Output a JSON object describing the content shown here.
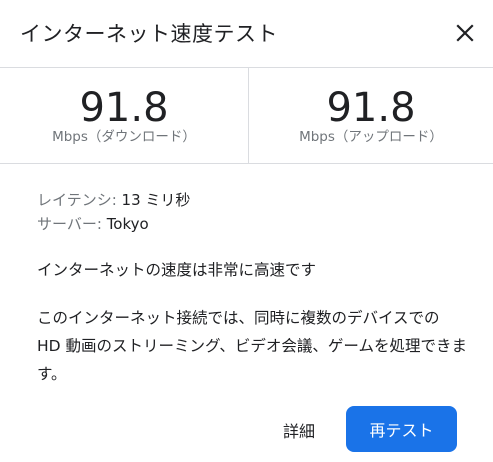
{
  "header": {
    "title": "インターネット速度テスト",
    "close_icon": "close-icon"
  },
  "results": {
    "download": {
      "value": "91.8",
      "unit": "Mbps（ダウンロード）"
    },
    "upload": {
      "value": "91.8",
      "unit": "Mbps（アップロード）"
    }
  },
  "meta": {
    "latency_label": "レイテンシ:",
    "latency_value": "13 ミリ秒",
    "server_label": "サーバー:",
    "server_value": "Tokyo"
  },
  "message": "インターネットの速度は非常に高速です",
  "description": "このインターネット接続では、同時に複数のデバイスでの HD 動画のストリーミング、ビデオ会議、ゲームを処理できます。",
  "actions": {
    "details_label": "詳細",
    "retest_label": "再テスト"
  },
  "colors": {
    "accent": "#1a73e8",
    "divider": "#dadce0",
    "secondary_text": "#70757a"
  }
}
